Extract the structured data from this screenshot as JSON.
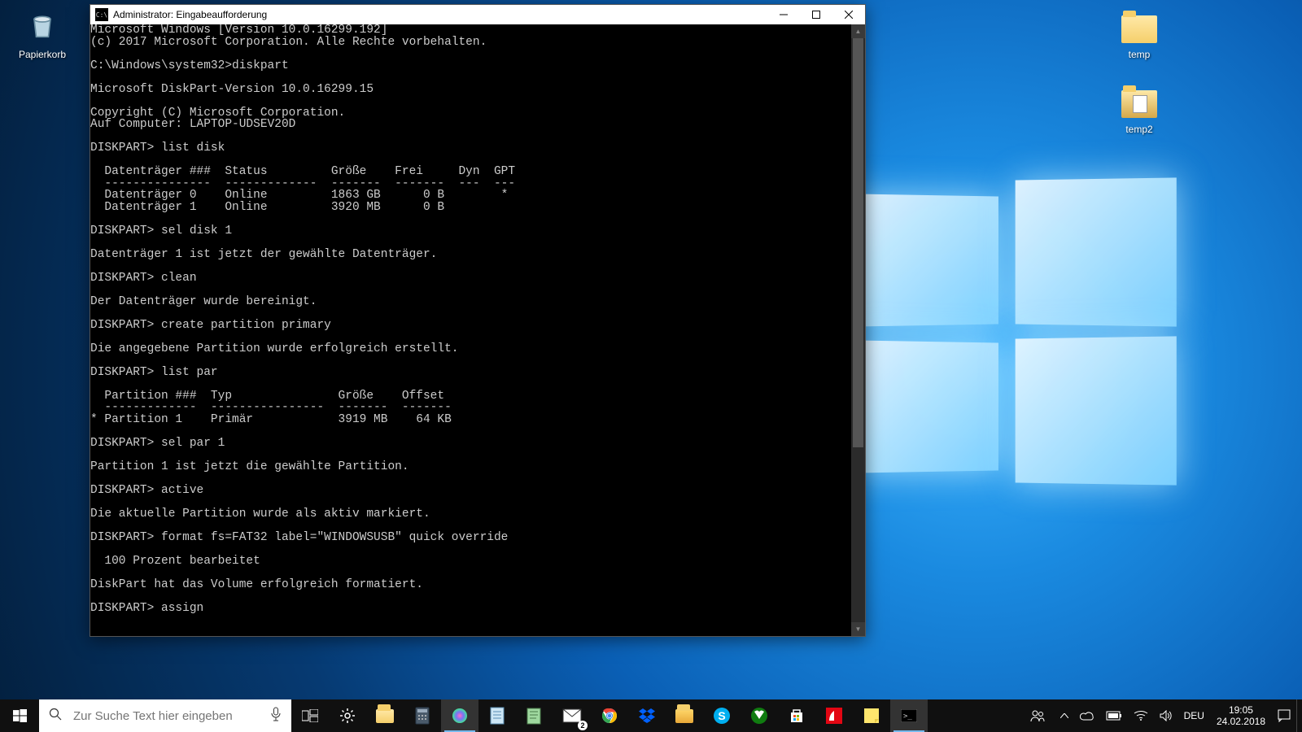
{
  "desktop_icons": {
    "recycle_bin": "Papierkorb",
    "folder1": "temp",
    "folder2": "temp2"
  },
  "cmd": {
    "title": "Administrator: Eingabeaufforderung",
    "content": "Microsoft Windows [Version 10.0.16299.192]\n(c) 2017 Microsoft Corporation. Alle Rechte vorbehalten.\n\nC:\\Windows\\system32>diskpart\n\nMicrosoft DiskPart-Version 10.0.16299.15\n\nCopyright (C) Microsoft Corporation.\nAuf Computer: LAPTOP-UDSEV20D\n\nDISKPART> list disk\n\n  Datenträger ###  Status         Größe    Frei     Dyn  GPT\n  ---------------  -------------  -------  -------  ---  ---\n  Datenträger 0    Online         1863 GB      0 B        *\n  Datenträger 1    Online         3920 MB      0 B\n\nDISKPART> sel disk 1\n\nDatenträger 1 ist jetzt der gewählte Datenträger.\n\nDISKPART> clean\n\nDer Datenträger wurde bereinigt.\n\nDISKPART> create partition primary\n\nDie angegebene Partition wurde erfolgreich erstellt.\n\nDISKPART> list par\n\n  Partition ###  Typ               Größe    Offset\n  -------------  ----------------  -------  -------\n* Partition 1    Primär            3919 MB    64 KB\n\nDISKPART> sel par 1\n\nPartition 1 ist jetzt die gewählte Partition.\n\nDISKPART> active\n\nDie aktuelle Partition wurde als aktiv markiert.\n\nDISKPART> format fs=FAT32 label=\"WINDOWSUSB\" quick override\n\n  100 Prozent bearbeitet\n\nDiskPart hat das Volume erfolgreich formatiert.\n\nDISKPART> assign\n"
  },
  "search": {
    "placeholder": "Zur Suche Text hier eingeben"
  },
  "tray": {
    "lang": "DEU",
    "time": "19:05",
    "date": "24.02.2018",
    "mail_badge": "2"
  }
}
